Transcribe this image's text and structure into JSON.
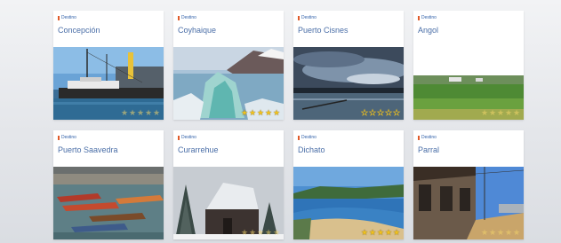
{
  "destinations": [
    {
      "kicker": "Destino",
      "city": "Concepción",
      "rating": 5,
      "rating_style": "faint",
      "photo": "ship-harbor"
    },
    {
      "kicker": "Destino",
      "city": "Coyhaique",
      "rating": 5,
      "rating_style": "solid",
      "photo": "glacier"
    },
    {
      "kicker": "Destino",
      "city": "Puerto Cisnes",
      "rating": 0,
      "rating_style": "outline",
      "photo": "dusk-bay"
    },
    {
      "kicker": "Destino",
      "city": "Angol",
      "rating": 5,
      "rating_style": "faint",
      "photo": "green-field"
    },
    {
      "kicker": "Destino",
      "city": "Puerto Saavedra",
      "rating": 0,
      "rating_style": "none",
      "photo": "boats"
    },
    {
      "kicker": "Destino",
      "city": "Curarrehue",
      "rating": 5,
      "rating_style": "faint",
      "photo": "snow-church"
    },
    {
      "kicker": "Destino",
      "city": "Dichato",
      "rating": 5,
      "rating_style": "solid",
      "photo": "coast-bay"
    },
    {
      "kicker": "Destino",
      "city": "Parral",
      "rating": 5,
      "rating_style": "faint",
      "photo": "old-station"
    }
  ],
  "colors": {
    "accent_text": "#4a6ea7",
    "kicker_text": "#2e5fa8",
    "pin": "#e05a2a",
    "star": "#f2c21a"
  }
}
